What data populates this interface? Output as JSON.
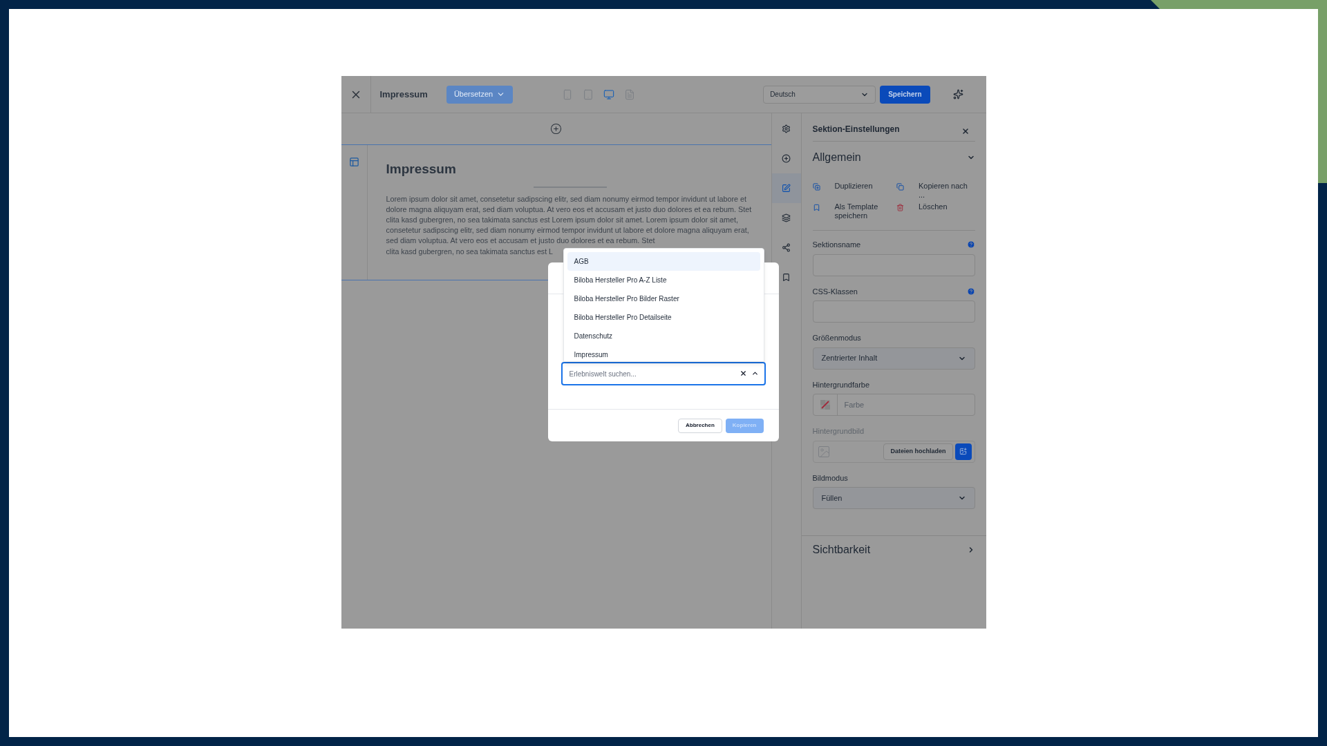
{
  "topbar": {
    "title": "Impressum",
    "translate_button": {
      "label": "Übersetzen",
      "disabled": true
    },
    "devices": [
      {
        "kind": "mobile",
        "selected": false
      },
      {
        "kind": "tablet",
        "selected": false
      },
      {
        "kind": "desktop",
        "selected": true
      },
      {
        "kind": "list",
        "selected": false
      }
    ],
    "language": "Deutsch",
    "save_button": "Speichern"
  },
  "canvas": {
    "heading": "Impressum",
    "text": "Lorem ipsum dolor sit amet, consetetur sadipscing elitr, sed diam nonumy eirmod tempor invidunt ut labore et dolore magna aliquyam erat, sed diam voluptua. At vero eos et accusam et justo duo dolores et ea rebum. Stet clita kasd gubergren, no sea takimata sanctus est Lorem ipsum dolor sit amet. Lorem ipsum dolor sit amet, consetetur sadipscing elitr, sed diam nonumy eirmod tempor invidunt ut labore et dolore magna aliquyam erat, sed diam voluptua. At vero eos et accusam et justo duo dolores et ea rebum. Stet",
    "text_end": "clita kasd gubergren, no sea takimata sanctus est L"
  },
  "tool_strip": [
    {
      "kind": "settings",
      "selected": false
    },
    {
      "kind": "add",
      "selected": false
    },
    {
      "kind": "edit",
      "selected": true
    },
    {
      "kind": "layers",
      "selected": false
    },
    {
      "kind": "share",
      "selected": false
    },
    {
      "kind": "bookmark",
      "selected": false
    }
  ],
  "panel": {
    "title": "Sektion-Einstellungen",
    "general": {
      "title": "Allgemein",
      "expanded": true
    },
    "actions": [
      {
        "kind": "duplicate",
        "label": "Duplizieren"
      },
      {
        "kind": "copy",
        "label": "Kopieren nach ..."
      },
      {
        "kind": "template",
        "label": "Als Template speichern"
      },
      {
        "kind": "delete",
        "label": "Löschen"
      }
    ],
    "fields": [
      {
        "kind": "text",
        "label": "Sektionsname",
        "help": true
      },
      {
        "kind": "text",
        "label": "CSS-Klassen",
        "help": true
      },
      {
        "kind": "select",
        "label": "Größenmodus",
        "value": "Zentrierter Inhalt"
      },
      {
        "kind": "color",
        "label": "Hintergrundfarbe",
        "placeholder": "Farbe"
      },
      {
        "kind": "image",
        "label": "Hintergrundbild",
        "button": "Dateien hochladen",
        "disabled": true
      },
      {
        "kind": "select",
        "label": "Bildmodus",
        "value": "Füllen"
      }
    ],
    "visibility": {
      "title": "Sichtbarkeit",
      "expanded": false
    }
  },
  "dialog": {
    "search": {
      "placeholder": "Erlebniswelt suchen..."
    },
    "expanded": true,
    "options": [
      {
        "label": "AGB",
        "selected": true
      },
      {
        "label": "Biloba Hersteller Pro A-Z Liste",
        "selected": false
      },
      {
        "label": "Biloba Hersteller Pro Bilder Raster",
        "selected": false
      },
      {
        "label": "Biloba Hersteller Pro Detailseite",
        "selected": false
      },
      {
        "label": "Datenschutz",
        "selected": false
      },
      {
        "label": "Impressum",
        "selected": false
      }
    ],
    "buttons": [
      {
        "kind": "secondary",
        "label": "Abbrechen",
        "disabled": false
      },
      {
        "kind": "primary",
        "label": "Kopieren",
        "disabled": true
      }
    ]
  }
}
